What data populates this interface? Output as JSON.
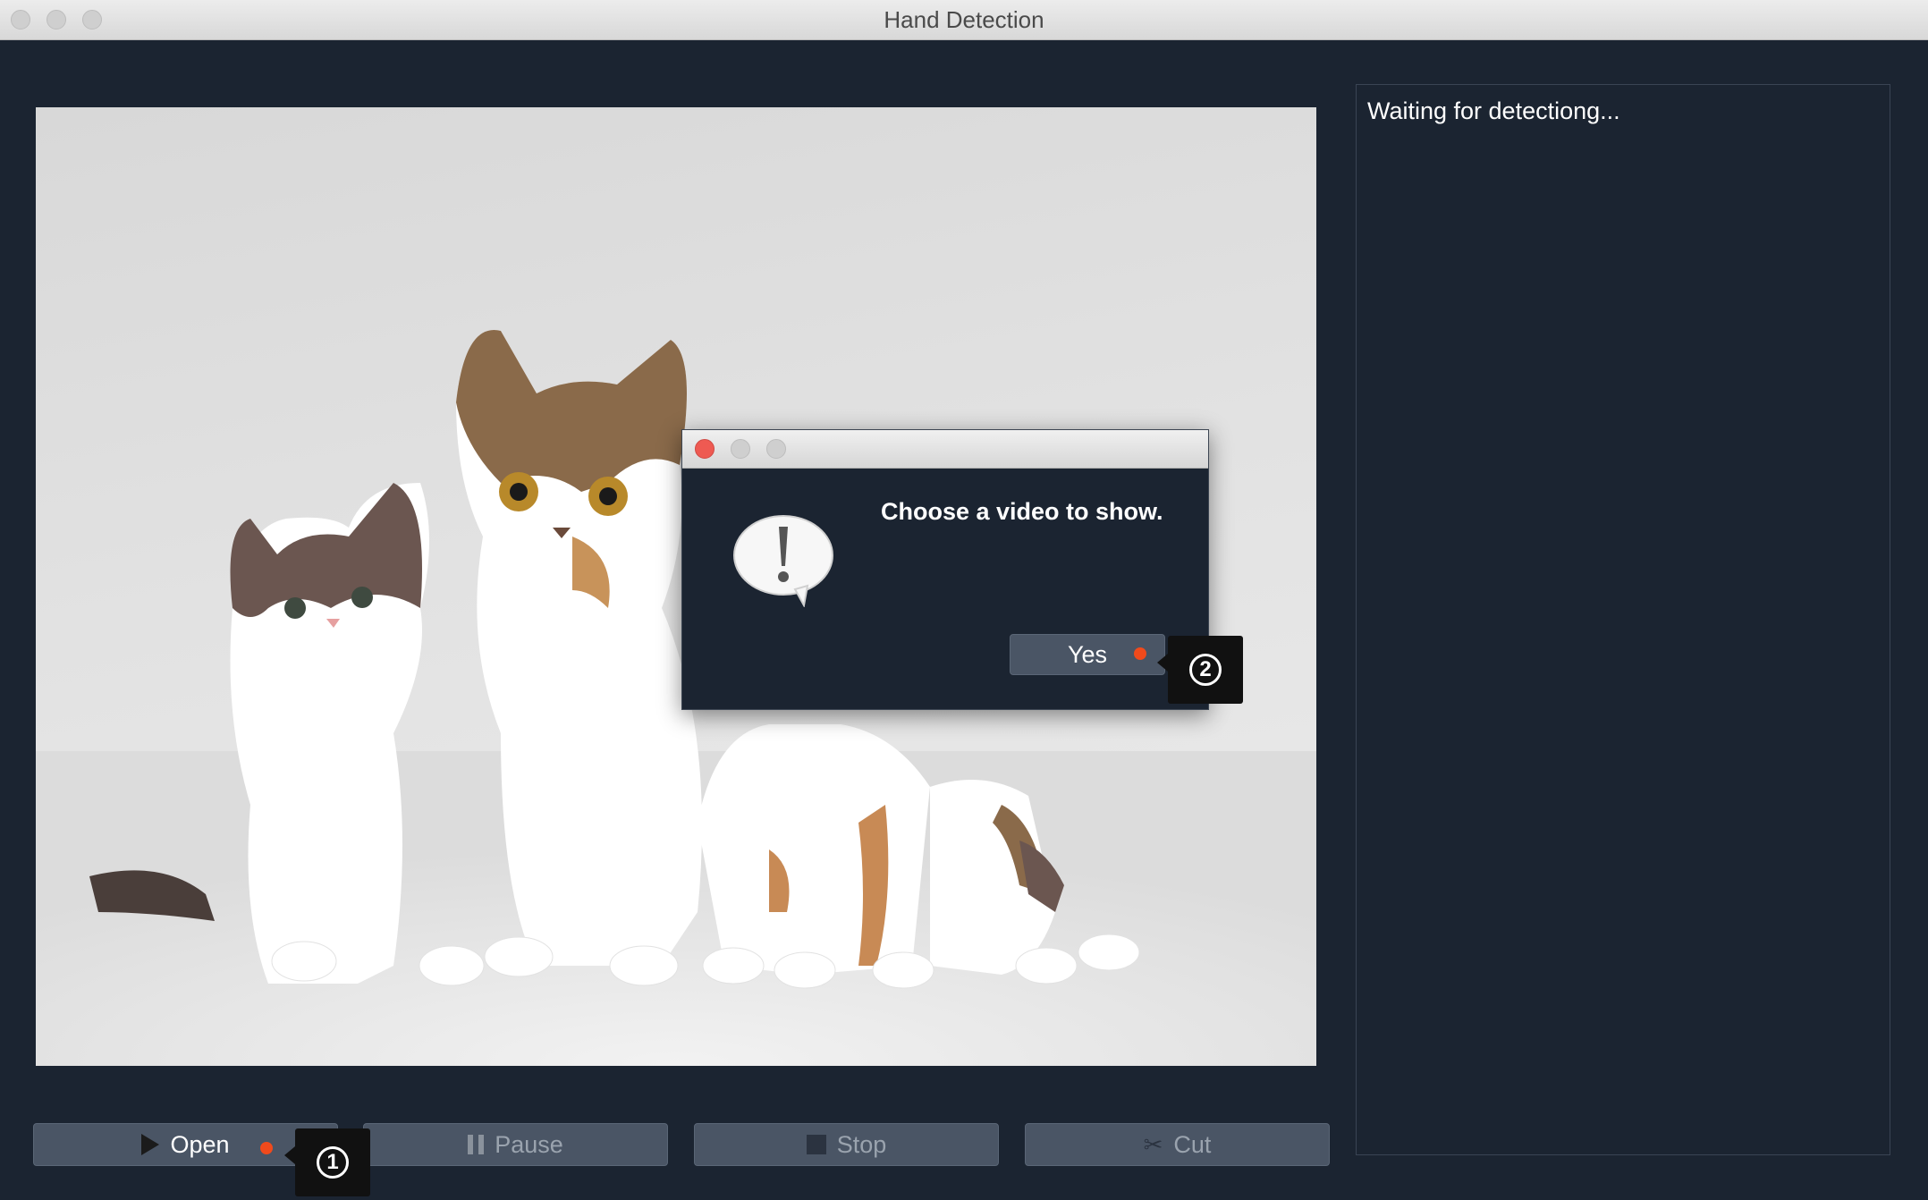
{
  "window": {
    "title": "Hand Detection"
  },
  "status": {
    "text": "Waiting for detectiong..."
  },
  "controls": {
    "open_label": "Open",
    "pause_label": "Pause",
    "stop_label": "Stop",
    "cut_label": "Cut"
  },
  "dialog": {
    "message": "Choose a video to show.",
    "yes_label": "Yes"
  },
  "markers": {
    "one": "1",
    "two": "2"
  },
  "colors": {
    "background": "#1b2431",
    "button": "#4a5565",
    "accent_dot": "#f04a1c"
  },
  "icons": {
    "open": "play-icon",
    "pause": "pause-icon",
    "stop": "stop-icon",
    "cut": "cut-icon",
    "alert": "alert-speech-bubble-icon"
  }
}
